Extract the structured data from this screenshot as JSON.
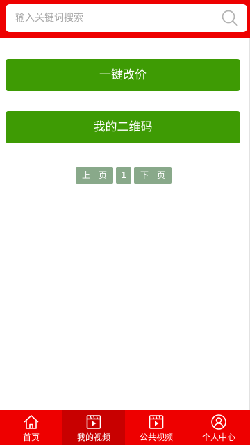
{
  "search": {
    "placeholder": "输入关键词搜索",
    "icon": "search-icon"
  },
  "actions": {
    "price_label": "一键改价",
    "qrcode_label": "我的二维码",
    "button_color": "#3e9b04"
  },
  "pagination": {
    "prev_label": "上一页",
    "current_page": "1",
    "next_label": "下一页"
  },
  "tabbar": {
    "background": "#ee0000",
    "active_background": "#c80000",
    "active_index": 1,
    "items": [
      {
        "label": "首页",
        "icon": "home-icon"
      },
      {
        "label": "我的视频",
        "icon": "video-icon"
      },
      {
        "label": "公共视频",
        "icon": "video-icon"
      },
      {
        "label": "个人中心",
        "icon": "user-icon"
      }
    ]
  }
}
